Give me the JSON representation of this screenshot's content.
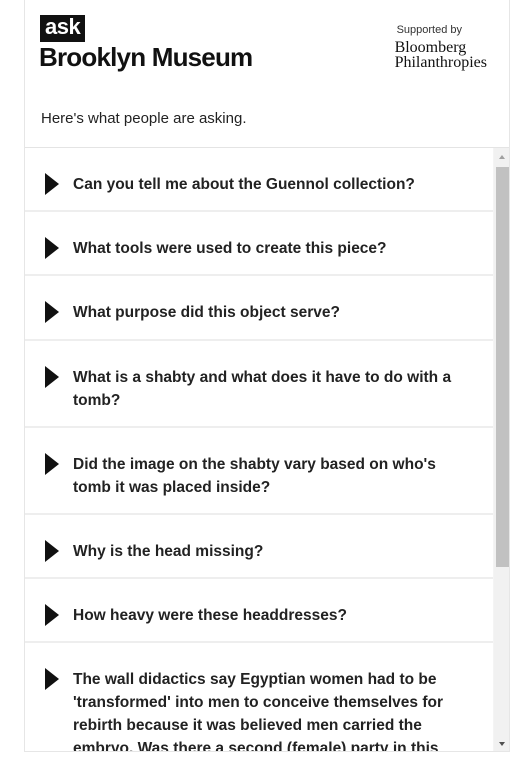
{
  "header": {
    "logo_ask": "ask",
    "logo_museum": "Brooklyn Museum",
    "sponsor_label": "Supported by",
    "sponsor_name": "Bloomberg\nPhilanthropies"
  },
  "intro_text": "Here's what people are asking.",
  "questions": [
    "Can you tell me about the Guennol collection?",
    "What tools were used to create this piece?",
    "What purpose did this object serve?",
    "What is a shabty and what does it have to do with a tomb?",
    "Did the image on the shabty vary based on who's tomb it was placed inside?",
    "Why is the head missing?",
    "How heavy were these headdresses?",
    "The wall didactics say Egyptian women had to be 'transformed' into men to conceive themselves for rebirth because it was believed men carried the embryo. Was there a second (female) party in this"
  ],
  "colors": {
    "arrow": "#111111",
    "scroll_thumb": "#c1c1c1"
  },
  "icons": {
    "expand": "triangle-right-icon",
    "scroll_up": "scroll-up-arrow-icon",
    "scroll_down": "scroll-down-arrow-icon"
  }
}
